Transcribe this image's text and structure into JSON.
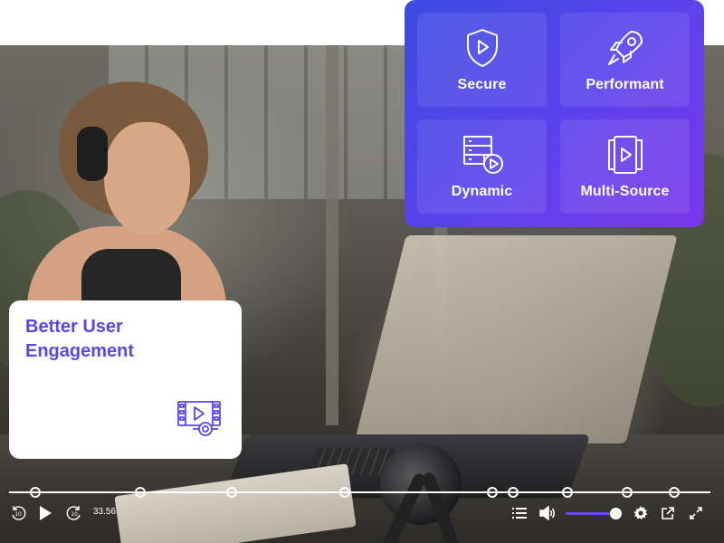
{
  "features": {
    "items": [
      {
        "label": "Secure",
        "icon": "shield-play-icon"
      },
      {
        "label": "Performant",
        "icon": "rocket-icon"
      },
      {
        "label": "Dynamic",
        "icon": "server-play-icon"
      },
      {
        "label": "Multi-Source",
        "icon": "video-stack-icon"
      }
    ],
    "gradient": [
      "#3a4be0",
      "#7a36ea"
    ]
  },
  "engagement": {
    "title": "Better User Engagement",
    "icon": "film-play-icon",
    "accent": "#5b45e6"
  },
  "player": {
    "time": "33.56",
    "volume_fraction": 0.85,
    "marker_count": 11,
    "accent": "#6b47ee"
  }
}
